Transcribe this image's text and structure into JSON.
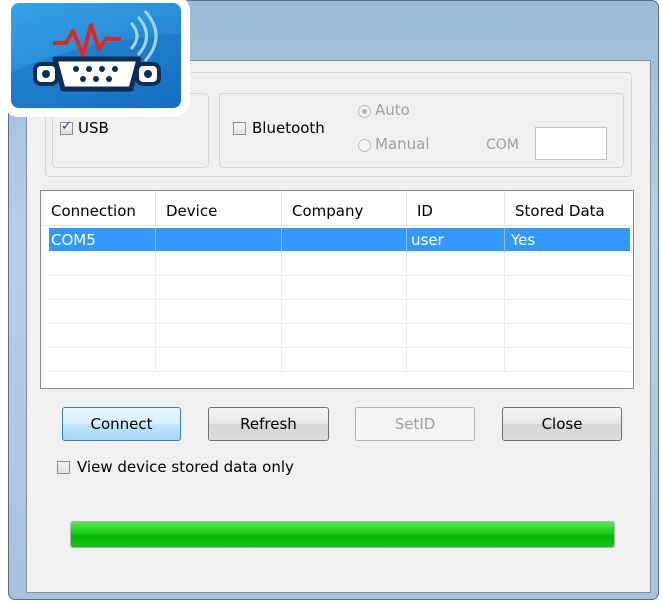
{
  "connection": {
    "usb": {
      "label": "USB",
      "checked": true
    },
    "bluetooth": {
      "label": "Bluetooth",
      "checked": false
    },
    "mode_auto": "Auto",
    "mode_manual": "Manual",
    "com_label": "COM",
    "com_value": ""
  },
  "table": {
    "columns": [
      "Connection",
      "Device",
      "Company",
      "ID",
      "Stored Data"
    ],
    "rows": [
      {
        "connection": "COM5",
        "device": "",
        "company": "",
        "id": "user",
        "stored": "Yes"
      }
    ]
  },
  "buttons": {
    "connect": "Connect",
    "refresh": "Refresh",
    "setid": "SetID",
    "close": "Close"
  },
  "view_stored_only": "View device stored data only",
  "progress": {
    "value": 1.0
  },
  "colors": {
    "selection": "#3399ff",
    "progress": "#14c414"
  },
  "icons": {
    "logo": "serial-port-signal-icon"
  }
}
